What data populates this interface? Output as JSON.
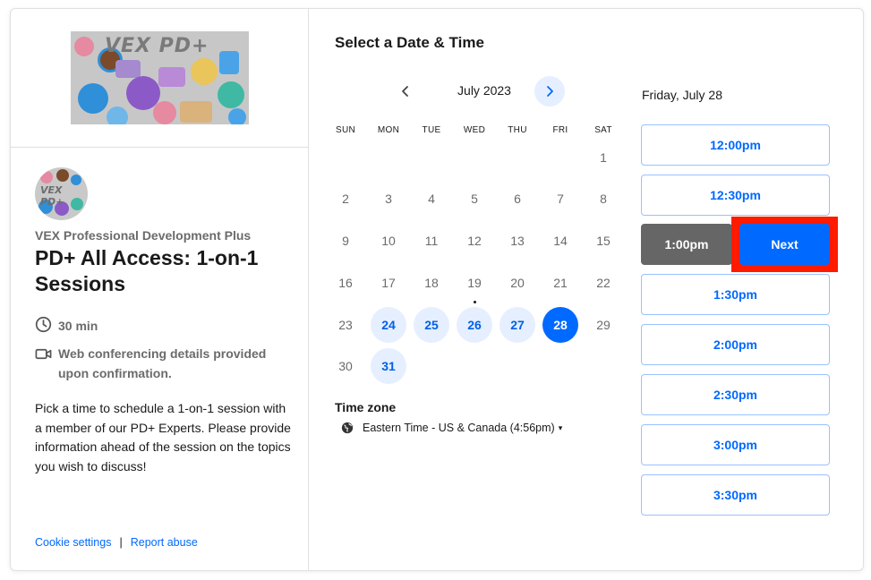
{
  "colors": {
    "brand_blue": "#0069ff",
    "available_day_bg": "#e6efff",
    "selected_slot_bg": "#666666",
    "highlight_red": "#ff1a00",
    "slot_border": "#99c1ff"
  },
  "banner": {
    "logo_text": "VEX PD+"
  },
  "avatar": {
    "logo_text": "VEX PD+"
  },
  "organizer": "VEX Professional Development Plus",
  "event": {
    "title": "PD+ All Access: 1-on-1 Sessions",
    "duration": "30 min",
    "duration_icon": "clock-icon",
    "conferencing": "Web conferencing details provided upon confirmation.",
    "conferencing_icon": "video-camera-icon",
    "description": "Pick a time to schedule a 1-on-1 session with a member of our PD+ Experts. Please provide information ahead of the session on the topics you wish to discuss!"
  },
  "footer": {
    "cookie_settings": "Cookie settings",
    "separator": "|",
    "report_abuse": "Report abuse"
  },
  "calendar": {
    "section_title": "Select a Date & Time",
    "month_label": "July 2023",
    "prev_icon": "chevron-left-icon",
    "next_icon": "chevron-right-icon",
    "weekdays": [
      "SUN",
      "MON",
      "TUE",
      "WED",
      "THU",
      "FRI",
      "SAT"
    ],
    "weeks": [
      [
        null,
        null,
        null,
        null,
        null,
        null,
        "1"
      ],
      [
        "2",
        "3",
        "4",
        "5",
        "6",
        "7",
        "8"
      ],
      [
        "9",
        "10",
        "11",
        "12",
        "13",
        "14",
        "15"
      ],
      [
        "16",
        "17",
        "18",
        "19",
        "20",
        "21",
        "22"
      ],
      [
        "23",
        "24",
        "25",
        "26",
        "27",
        "28",
        "29"
      ],
      [
        "30",
        "31",
        null,
        null,
        null,
        null,
        null
      ]
    ],
    "available_days": [
      "24",
      "25",
      "26",
      "27",
      "28",
      "31"
    ],
    "selected_day": "28",
    "today": "19"
  },
  "timezone": {
    "title": "Time zone",
    "value": "Eastern Time - US & Canada (4:56pm)",
    "icon": "globe-icon",
    "caret": "▾"
  },
  "times": {
    "date_heading": "Friday, July 28",
    "slots": [
      "12:00pm",
      "12:30pm",
      "1:00pm",
      "1:30pm",
      "2:00pm",
      "2:30pm",
      "3:00pm",
      "3:30pm"
    ],
    "selected": "1:00pm",
    "next_label": "Next"
  }
}
